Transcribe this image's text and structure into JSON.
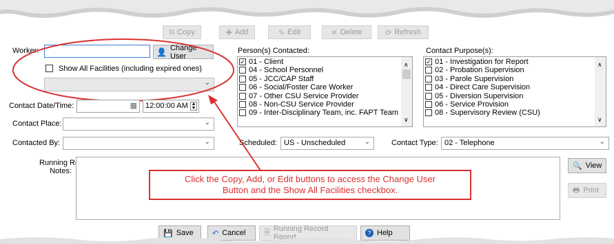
{
  "toolbar": {
    "copy": "Copy",
    "add": "Add",
    "edit": "Edit",
    "delete": "Delete",
    "refresh": "Refresh"
  },
  "worker": {
    "label": "Worker:",
    "value": "",
    "change_user": "Change User",
    "show_all_label": "Show All Facilities (including expired ones)",
    "show_all_checked": false,
    "facility_value": ""
  },
  "contact_datetime": {
    "label": "Contact Date/Time:",
    "date": "",
    "time": "12:00:00 AM"
  },
  "contact_place": {
    "label": "Contact Place:",
    "value": ""
  },
  "contacted_by": {
    "label": "Contacted By:",
    "value": ""
  },
  "persons_contacted": {
    "label": "Person(s) Contacted:",
    "items": [
      {
        "label": "01 - Client",
        "checked": true
      },
      {
        "label": "04 - School Personnel",
        "checked": false
      },
      {
        "label": "05 - JCC/CAP Staff",
        "checked": false
      },
      {
        "label": "06 - Social/Foster Care Worker",
        "checked": false
      },
      {
        "label": "07 - Other CSU Service Provider",
        "checked": false
      },
      {
        "label": "08 - Non-CSU Service Provider",
        "checked": false
      },
      {
        "label": "09 - Inter-Disciplinary Team, inc. FAPT Team",
        "checked": false
      }
    ]
  },
  "contact_purpose": {
    "label": "Contact Purpose(s):",
    "items": [
      {
        "label": "01 - Investigation for Report",
        "checked": true
      },
      {
        "label": "02 - Probation Supervision",
        "checked": false
      },
      {
        "label": "03 - Parole Supervision",
        "checked": false
      },
      {
        "label": "04 - Direct Care Supervision",
        "checked": false
      },
      {
        "label": "05 - Diversion Supervision",
        "checked": false
      },
      {
        "label": "06 - Service Provision",
        "checked": false
      },
      {
        "label": "08 - Supervisory Review (CSU)",
        "checked": false
      }
    ]
  },
  "scheduled": {
    "label": "Scheduled:",
    "value": "US - Unscheduled"
  },
  "contact_type": {
    "label": "Contact Type:",
    "value": "02 - Telephone"
  },
  "running_notes": {
    "label_line1": "Running Record",
    "label_line2": "Notes:",
    "value": ""
  },
  "side_buttons": {
    "view": "View",
    "print": "Print"
  },
  "bottom": {
    "save": "Save",
    "cancel": "Cancel",
    "report": "Running Record Report",
    "help": "Help"
  },
  "callout": {
    "line1": "Click the Copy, Add, or Edit buttons to access the Change User",
    "line2": "Button and the Show All Facilities checkbox."
  },
  "colors": {
    "annotation_red": "#d9302f",
    "panel_bg": "#ffffff"
  }
}
